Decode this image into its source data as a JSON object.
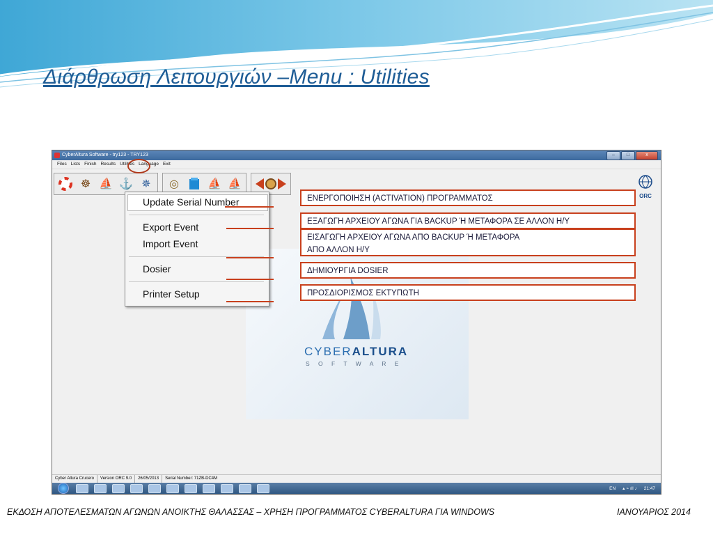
{
  "slide": {
    "title": "Διάρθρωση Λειτουργιών –Menu : Utilities",
    "footer_left": "ΕΚΔΟΣΗ ΑΠΟΤΕΛΕΣΜΑΤΩΝ ΑΓΩΝΩΝ ΑΝΟΙΚΤΗΣ ΘΑΛΑΣΣΑΣ – ΧΡΗΣΗ ΠΡΟΓΡΑΜΜΑΤΟΣ CYBERALTURA ΓΙΑ WINDOWS",
    "footer_right": "ΙΑΝΟΥΑΡΙΟΣ 2014",
    "accent_color": "#c8401d",
    "title_color": "#1f5d96"
  },
  "window": {
    "title": "CyberAltura Software - try123 - TRY123",
    "buttons": [
      "minimize-icon",
      "maximize-icon",
      "close-icon"
    ],
    "menu": [
      "Files",
      "Lists",
      "Finish",
      "Results",
      "Utilities",
      "Language",
      "Exit"
    ],
    "toolbar_group1": [
      "lifebuoy-icon",
      "ship-wheel-icon",
      "sailboat-icon",
      "anchor-icon",
      "compass-rose-icon"
    ],
    "toolbar_group2": [
      "compass-icon",
      "book-icon",
      "sail-icon",
      "regatta-icon"
    ],
    "toolbar_group3": [
      "navigation-arrows-icon"
    ],
    "orc_label": "ORC",
    "splash": {
      "brand_left": "CYBER",
      "brand_right": "ALTURA",
      "brand_sub": "S O F T W A R E"
    },
    "status": [
      "Cyber Altura Crucero",
      "Version ORC 9.0",
      "26/05/2013",
      "Serial Number: 71ZB-DC4M"
    ],
    "tray": {
      "language": "EN",
      "time": "21:47"
    }
  },
  "dropdown": {
    "items": [
      "Update Serial Number",
      "Export Event",
      "Import Event",
      "Dosier",
      "Printer Setup"
    ]
  },
  "callouts": {
    "activation": "ΕΝΕΡΓΟΠΟΙΗΣΗ (ACTIVATION) ΠΡΟΓΡΑΜΜΑΤΟΣ",
    "export": "ΕΞΑΓΩΓΗ ΑΡΧΕΙΟΥ ΑΓΩΝΑ ΓΙΑ BACKUP Ή ΜΕΤΑΦΟΡΑ ΣΕ ΑΛΛΟΝ Η/Υ",
    "import_line1": "ΕΙΣΑΓΩΓΗ ΑΡΧΕΙΟΥ ΑΓΩΝΑ ΑΠΟ BACKUP Ή ΜΕΤΑΦΟΡΑ",
    "import_line2": "ΑΠΟ ΑΛΛΟΝ Η/Υ",
    "dosier": "ΔΗΜΙΟΥΡΓΙΑ DOSIER",
    "printer": "ΠΡΟΣΔΙΟΡΙΣΜΟΣ ΕΚΤΥΠΩΤΗ"
  }
}
